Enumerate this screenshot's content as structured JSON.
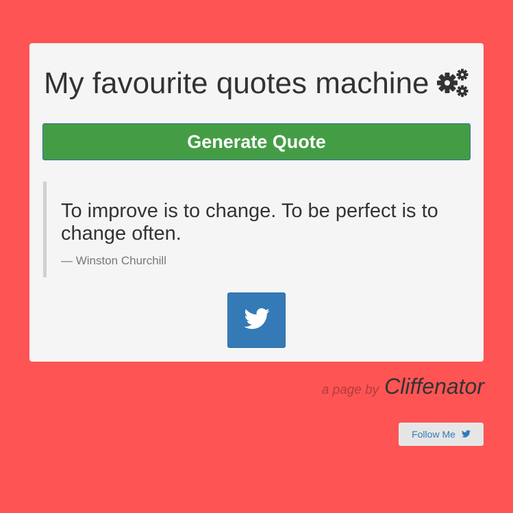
{
  "header": {
    "title": "My favourite quotes machine",
    "title_icon": "gears-icon"
  },
  "actions": {
    "generate_label": "Generate Quote"
  },
  "quote": {
    "text": "To improve is to change. To be perfect is to change often.",
    "author": "— Winston Churchill"
  },
  "share": {
    "tweet_icon": "twitter-icon"
  },
  "footer": {
    "byline_prefix": "a page by",
    "byline_name": "Cliffenator",
    "follow_label": "Follow Me",
    "follow_icon": "twitter-icon"
  },
  "colors": {
    "background": "#ff5454",
    "card": "#f5f5f5",
    "generate_button": "#449d44",
    "tweet_button": "#337ab7",
    "follow_button": "#e6e6e6"
  }
}
